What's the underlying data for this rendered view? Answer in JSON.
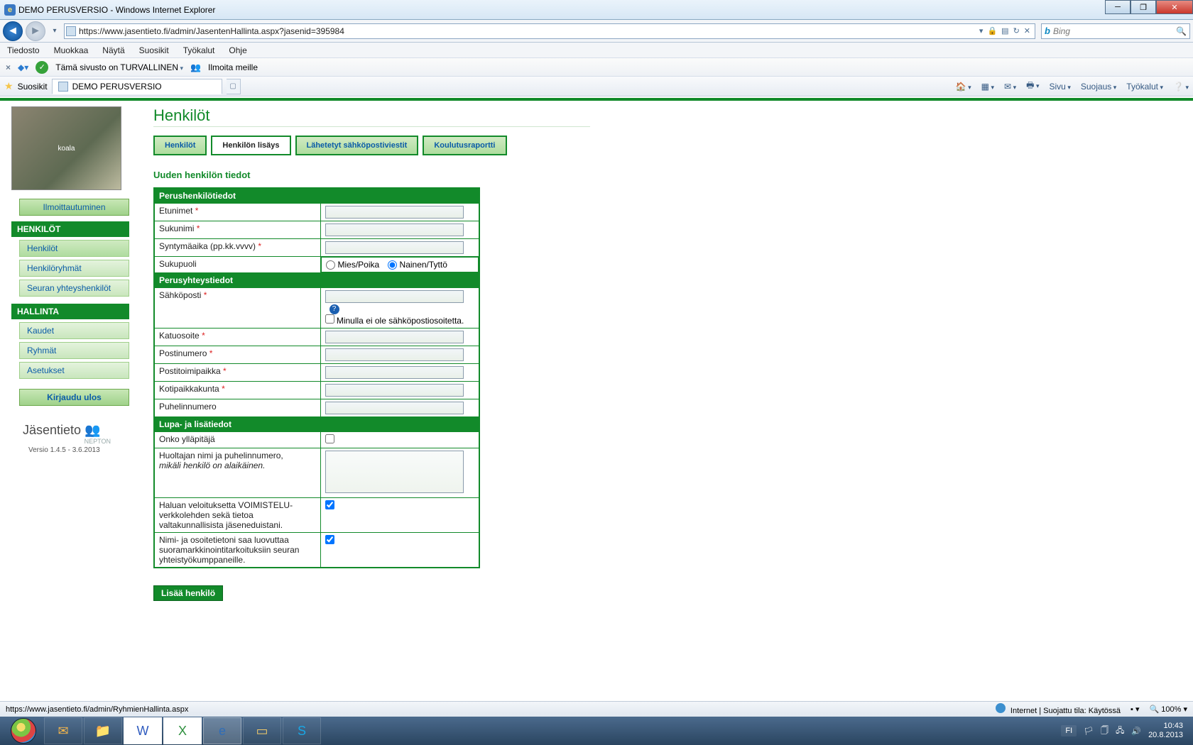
{
  "window": {
    "title": "DEMO PERUSVERSIO - Windows Internet Explorer"
  },
  "nav": {
    "url": "https://www.jasentieto.fi/admin/JasentenHallinta.aspx?jasenid=395984"
  },
  "search": {
    "placeholder": "Bing"
  },
  "menubar": [
    "Tiedosto",
    "Muokkaa",
    "Näytä",
    "Suosikit",
    "Työkalut",
    "Ohje"
  ],
  "secrow": {
    "safe": "Tämä sivusto on TURVALLINEN",
    "report": "Ilmoita meille"
  },
  "fav": {
    "label": "Suosikit",
    "tab": "DEMO PERUSVERSIO",
    "tools": [
      "Sivu",
      "Suojaus",
      "Työkalut"
    ]
  },
  "sidebar": {
    "register": "Ilmoittautuminen",
    "h1": "HENKILÖT",
    "g1": [
      "Henkilöt",
      "Henkilöryhmät",
      "Seuran yhteyshenkilöt"
    ],
    "h2": "HALLINTA",
    "g2": [
      "Kaudet",
      "Ryhmät",
      "Asetukset"
    ],
    "logout": "Kirjaudu ulos",
    "brand": "Jäsentieto",
    "brand_sub": "NEPTON",
    "version": "Versio 1.4.5 - 3.6.2013"
  },
  "page": {
    "title": "Henkilöt",
    "tabs": [
      "Henkilöt",
      "Henkilön lisäys",
      "Lähetetyt sähköpostiviestit",
      "Koulutusraportti"
    ],
    "active_tab": 1,
    "sub": "Uuden henkilön tiedot"
  },
  "sections": {
    "s1": "Perushenkilötiedot",
    "s2": "Perusyhteystiedot",
    "s3": "Lupa- ja lisätiedot"
  },
  "fields": {
    "etunimet": "Etunimet",
    "sukunimi": "Sukunimi",
    "synt": "Syntymäaika (pp.kk.vvvv)",
    "sukupuoli": "Sukupuoli",
    "sp_m": "Mies/Poika",
    "sp_n": "Nainen/Tyttö",
    "email": "Sähköposti",
    "noemail": "Minulla ei ole sähköpostiosoitetta.",
    "katu": "Katuosoite",
    "pnro": "Postinumero",
    "ptp": "Postitoimipaikka",
    "koti": "Kotipaikkakunta",
    "puh": "Puhelinnumero",
    "admin": "Onko ylläpitäjä",
    "huolt1": "Huoltajan nimi ja puhelinnumero,",
    "huolt2": "mikäli henkilö on alaikäinen.",
    "lupa1": "Haluan veloituksetta VOIMISTELU-verkkolehden sekä tietoa valtakunnallisista jäseneduistani.",
    "lupa2": "Nimi- ja osoitetietoni saa luovuttaa suoramarkkinointitarkoituksiin seuran yhteistyökumppaneille."
  },
  "buttons": {
    "add": "Lisää henkilö"
  },
  "statusbar": {
    "left": "https://www.jasentieto.fi/admin/RyhmienHallinta.aspx",
    "right": "Internet | Suojattu tila: Käytössä",
    "zoom": "100%"
  },
  "tray": {
    "lang": "FI",
    "time": "10:43",
    "date": "20.8.2013"
  }
}
